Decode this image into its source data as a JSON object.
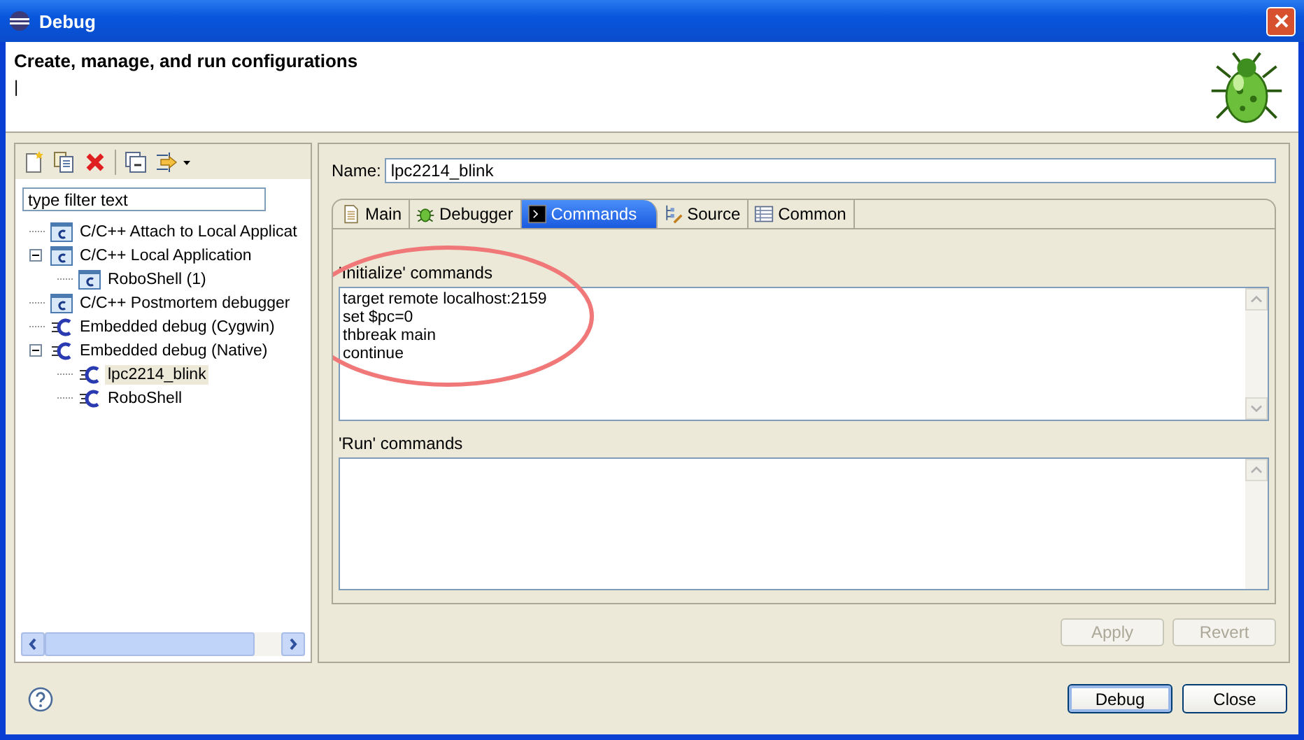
{
  "window": {
    "title": "Debug"
  },
  "header": {
    "title": "Create, manage, and run configurations",
    "message": "|"
  },
  "filter": {
    "placeholder": "type filter text"
  },
  "tree": [
    {
      "label": "C/C++ Attach to Local Applicat",
      "kind": "c-app",
      "selected": false
    },
    {
      "label": "C/C++ Local Application",
      "kind": "c-app",
      "selected": false,
      "expanded": true,
      "children": [
        {
          "label": "RoboShell (1)",
          "kind": "c-app",
          "selected": false
        }
      ]
    },
    {
      "label": "C/C++ Postmortem debugger",
      "kind": "c-app",
      "selected": false
    },
    {
      "label": "Embedded debug (Cygwin)",
      "kind": "embedded",
      "selected": false
    },
    {
      "label": "Embedded debug (Native)",
      "kind": "embedded",
      "selected": false,
      "expanded": true,
      "children": [
        {
          "label": "lpc2214_blink",
          "kind": "embedded",
          "selected": true
        },
        {
          "label": "RoboShell",
          "kind": "embedded",
          "selected": false
        }
      ]
    }
  ],
  "name_field": {
    "label": "Name:",
    "value": "lpc2214_blink"
  },
  "tabs": [
    {
      "label": "Main",
      "kind": "main",
      "selected": false
    },
    {
      "label": "Debugger",
      "kind": "debugger",
      "selected": false
    },
    {
      "label": "Commands",
      "kind": "commands",
      "selected": true
    },
    {
      "label": "Source",
      "kind": "source",
      "selected": false
    },
    {
      "label": "Common",
      "kind": "common",
      "selected": false
    }
  ],
  "sections": [
    {
      "label": "'Initialize' commands",
      "value": "target remote localhost:2159\nset $pc=0\nthbreak main\ncontinue"
    },
    {
      "label": "'Run' commands"
    }
  ],
  "panel_buttons": [
    {
      "label": "Apply",
      "disabled": true
    },
    {
      "label": "Revert",
      "disabled": true
    }
  ],
  "dialog_buttons": [
    {
      "label": "Debug",
      "default": true
    },
    {
      "label": "Close",
      "default": false
    }
  ]
}
